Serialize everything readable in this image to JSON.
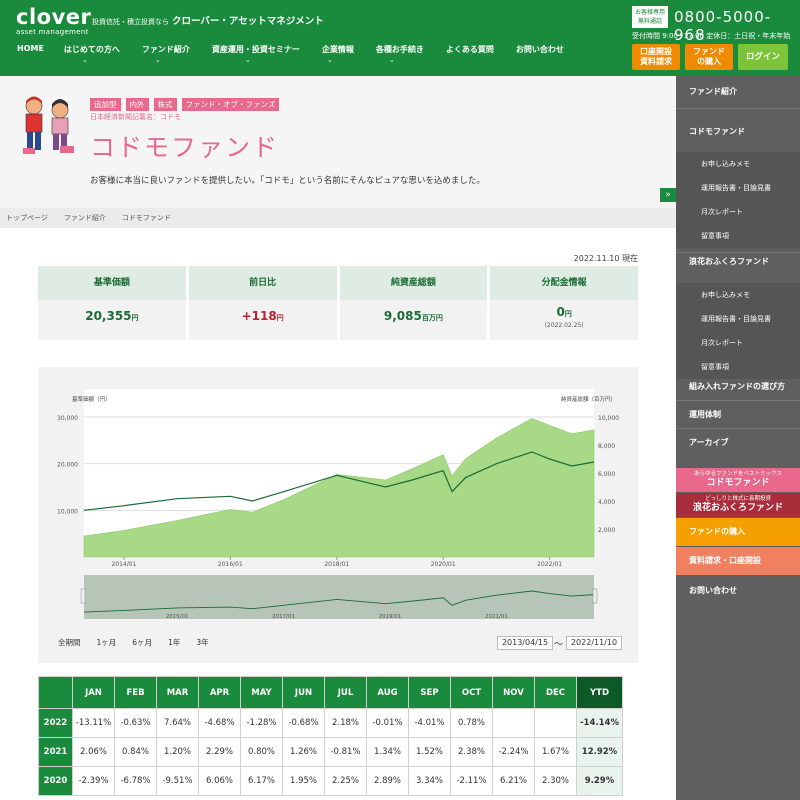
{
  "header": {
    "logo_main": "clover",
    "logo_sub": "asset management",
    "tagline_small": "投資信託・積立投資なら",
    "tagline_bold": "クローバー・アセットマネジメント",
    "call_badge_line1": "お客様専用",
    "call_badge_line2": "無料通話",
    "phone": "0800-5000-968",
    "hours": "受付時間 9:00~17:00 定休日：土日祝・年末年始",
    "nav": [
      "HOME",
      "はじめての方へ",
      "ファンド紹介",
      "資産運用・投資セミナー",
      "企業情報",
      "各種お手続き",
      "よくある質問",
      "お問い合わせ"
    ],
    "btn_account_line1": "口座開設",
    "btn_account_line2": "資料請求",
    "btn_buy_line1": "ファンド",
    "btn_buy_line2": "の購入",
    "btn_login": "ログイン"
  },
  "hero": {
    "tags": [
      "追加型",
      "内外",
      "株式",
      "ファンド・オブ・ファンズ"
    ],
    "nikkei": "日本経済新聞記載名：コドモ",
    "title": "コドモファンド",
    "description": "お客様に本当に良いファンドを提供したい。「コドモ」という名前にそんなピュアな思いを込めました。",
    "toggle": "»"
  },
  "breadcrumb": [
    "トップページ",
    "ファンド紹介",
    "コドモファンド"
  ],
  "as_of": "2022.11.10 現在",
  "stats": [
    {
      "label": "基準価額",
      "value": "20,355",
      "unit": "円",
      "note": ""
    },
    {
      "label": "前日比",
      "value": "+118",
      "unit": "円",
      "note": ""
    },
    {
      "label": "純資産総額",
      "value": "9,085",
      "unit": "百万円",
      "note": ""
    },
    {
      "label": "分配金情報",
      "value": "0",
      "unit": "円",
      "note": "(2022.02.25)"
    }
  ],
  "chart_data": {
    "type": "line",
    "left_axis_label": "基準価額（円）",
    "right_axis_label": "純資産総額（百万円）",
    "left_ticks": [
      "10,000",
      "20,000",
      "30,000"
    ],
    "right_ticks": [
      "2,000",
      "4,000",
      "6,000",
      "8,000",
      "10,000"
    ],
    "x_ticks": [
      "2014/01",
      "2016/01",
      "2018/01",
      "2020/01",
      "2022/01"
    ],
    "nav_x_ticks": [
      "2015/01",
      "2017/01",
      "2019/01",
      "2021/01"
    ],
    "ylim_left": [
      0,
      36000
    ],
    "ylim_right": [
      0,
      12000
    ],
    "series": [
      {
        "name": "基準価額",
        "x": [
          "2013/04",
          "2014/01",
          "2015/01",
          "2016/01",
          "2016/06",
          "2017/01",
          "2018/01",
          "2018/12",
          "2019/06",
          "2020/01",
          "2020/03",
          "2020/06",
          "2021/01",
          "2021/09",
          "2022/01",
          "2022/06",
          "2022/11"
        ],
        "values": [
          10000,
          11000,
          12500,
          13000,
          12000,
          14000,
          17500,
          15000,
          16500,
          18500,
          14000,
          17000,
          20000,
          22500,
          21000,
          19500,
          20355
        ]
      },
      {
        "name": "純資産総額",
        "x": [
          "2013/04",
          "2014/01",
          "2015/01",
          "2016/01",
          "2016/06",
          "2017/01",
          "2018/01",
          "2018/12",
          "2019/06",
          "2020/01",
          "2020/03",
          "2020/06",
          "2021/01",
          "2021/09",
          "2022/01",
          "2022/06",
          "2022/11"
        ],
        "values": [
          1500,
          1900,
          2600,
          3400,
          3200,
          4100,
          5900,
          5500,
          6300,
          7300,
          5800,
          7000,
          8500,
          9900,
          9400,
          8800,
          9085
        ]
      }
    ]
  },
  "range_options": [
    "全期間",
    "1ヶ月",
    "6ヶ月",
    "1年",
    "3年"
  ],
  "date_from": "2013/04/15",
  "date_tilde": "〜",
  "date_to": "2022/11/10",
  "performance": {
    "headers": [
      "JAN",
      "FEB",
      "MAR",
      "APR",
      "MAY",
      "JUN",
      "JUL",
      "AUG",
      "SEP",
      "OCT",
      "NOV",
      "DEC",
      "YTD"
    ],
    "rows": [
      {
        "year": "2022",
        "values": [
          "-13.11%",
          "-0.63%",
          "7.64%",
          "-4.68%",
          "-1.28%",
          "-0.68%",
          "2.18%",
          "-0.01%",
          "-4.01%",
          "0.78%",
          "",
          "",
          "-14.14%"
        ]
      },
      {
        "year": "2021",
        "values": [
          "2.06%",
          "0.84%",
          "1.20%",
          "2.29%",
          "0.80%",
          "1.26%",
          "-0.81%",
          "1.34%",
          "1.52%",
          "2.38%",
          "-2.24%",
          "1.67%",
          "12.92%"
        ]
      },
      {
        "year": "2020",
        "values": [
          "-2.39%",
          "-6.78%",
          "-9.51%",
          "6.06%",
          "6.17%",
          "1.95%",
          "2.25%",
          "2.89%",
          "3.34%",
          "-2.11%",
          "6.21%",
          "2.30%",
          "9.29%"
        ]
      }
    ]
  },
  "sidebar": {
    "sections": [
      "ファンド紹介",
      "コドモファンド",
      "浪花おふくろファンド",
      "組み入れファンドの選び方",
      "運用体制",
      "アーカイブ"
    ],
    "kodomo_items": [
      "お申し込みメモ",
      "運用報告書・目論見書",
      "月次レポート",
      "留意事項"
    ],
    "naniwa_items": [
      "お申し込みメモ",
      "運用報告書・目論見書",
      "月次レポート",
      "留意事項"
    ],
    "kodomo_banner_small": "あらゆるファンドをベストミックス",
    "kodomo_banner": "コドモファンド",
    "naniwa_banner_small": "どっしりと株式に長期投資",
    "naniwa_banner": "浪花おふくろファンド",
    "buy": "ファンドの購入",
    "docs": "資料請求・口座開設",
    "contact": "お問い合わせ"
  },
  "colors": {
    "brand_green": "#1a8a3c",
    "pink": "#e8698c",
    "orange": "#f08a00",
    "lime": "#7cc43a",
    "sidebar_gray": "#5f5f5f"
  }
}
